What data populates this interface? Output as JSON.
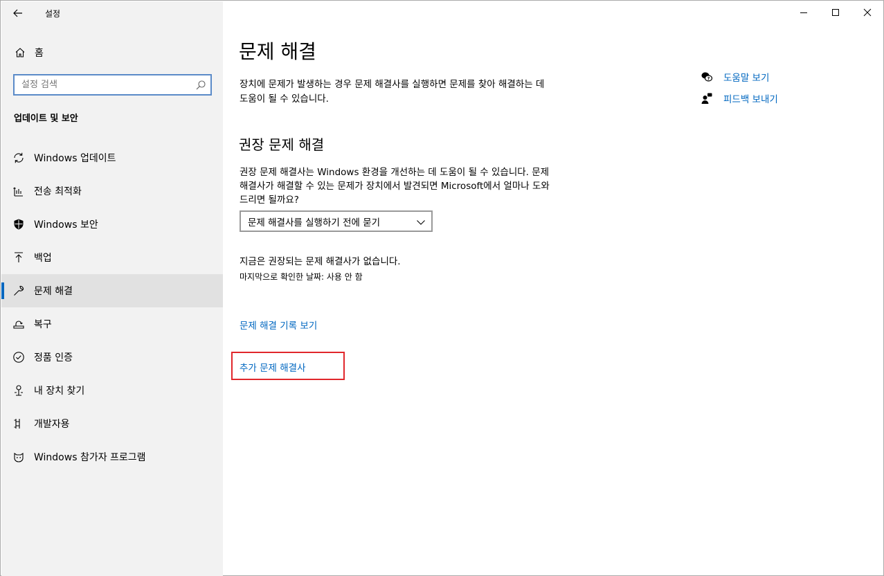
{
  "app": {
    "title": "설정"
  },
  "sidebar": {
    "home_label": "홈",
    "search_placeholder": "설정 검색",
    "section_title": "업데이트 및 보안",
    "items": [
      {
        "label": "Windows 업데이트",
        "icon": "sync-icon"
      },
      {
        "label": "전송 최적화",
        "icon": "delivery-optimization-icon"
      },
      {
        "label": "Windows 보안",
        "icon": "shield-icon"
      },
      {
        "label": "백업",
        "icon": "backup-arrow-icon"
      },
      {
        "label": "문제 해결",
        "icon": "wrench-icon",
        "active": true
      },
      {
        "label": "복구",
        "icon": "recovery-icon"
      },
      {
        "label": "정품 인증",
        "icon": "check-circle-icon"
      },
      {
        "label": "내 장치 찾기",
        "icon": "find-device-icon"
      },
      {
        "label": "개발자용",
        "icon": "developer-icon"
      },
      {
        "label": "Windows 참가자 프로그램",
        "icon": "insider-cat-icon"
      }
    ]
  },
  "main": {
    "title": "문제 해결",
    "description": "장치에 문제가 발생하는 경우 문제 해결사를 실행하면 문제를 찾아 해결하는 데 도움이 될 수 있습니다.",
    "recommended_title": "권장 문제 해결",
    "recommended_description": "권장 문제 해결사는 Windows 환경을 개선하는 데 도움이 될 수 있습니다. 문제 해결사가 해결할 수 있는 문제가 장치에서 발견되면 Microsoft에서 얼마나 도와드리면 될까요?",
    "dropdown_value": "문제 해결사를 실행하기 전에 묻기",
    "status_text": "지금은 권장되는 문제 해결사가 없습니다.",
    "last_check": "마지막으로 확인한 날짜: 사용 안 함",
    "history_link": "문제 해결 기록 보기",
    "more_link": "추가 문제 해결사"
  },
  "related": {
    "help_label": "도움말 보기",
    "feedback_label": "피드백 보내기"
  },
  "colors": {
    "accent": "#0067c0",
    "highlight": "#e0262b",
    "sidebar_bg": "#f2f2f2"
  }
}
